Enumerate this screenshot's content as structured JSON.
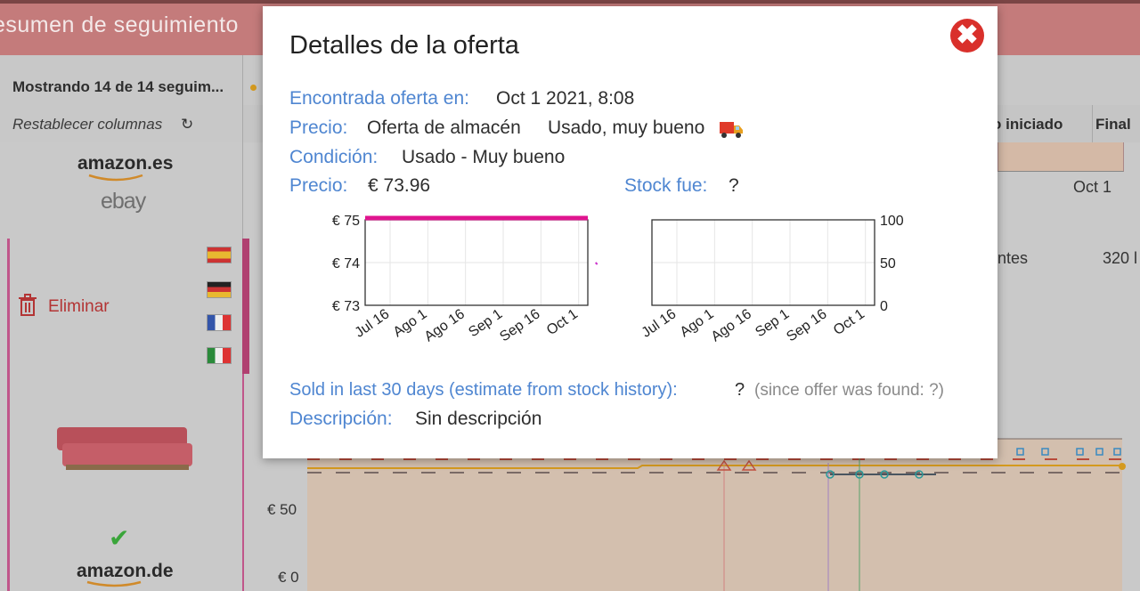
{
  "page": {
    "header_title": "esumen de seguimiento",
    "showing": "Mostrando 14 de 14 seguim...",
    "reset_columns": "Restablecer columnas",
    "col_started": "nto iniciado",
    "col_final": "Final",
    "row1": {
      "logo_1": "amazon.es",
      "logo_2": "ebay",
      "axis_label": "Oct 1"
    },
    "row2": {
      "delete_label": "Eliminar",
      "remaining": "antes",
      "remaining_value": "320 l"
    },
    "row3": {
      "logo": "amazon.de",
      "y_labels": [
        "€",
        "€ 50",
        "€ 0"
      ]
    },
    "colors": {
      "header": "#c47b7b",
      "accent_pink": "#c0568a",
      "link_blue": "#4f86d1",
      "close_red": "#d9302b"
    },
    "icons": [
      "reset-icon",
      "trash-icon",
      "flag-es-icon",
      "flag-de-icon",
      "flag-fr-icon",
      "flag-it-icon",
      "check-icon",
      "truck-icon",
      "close-icon"
    ]
  },
  "modal": {
    "title": "Detalles de la oferta",
    "found_label": "Encontrada oferta en:",
    "found_value": "Oct 1 2021, 8:08",
    "price_type_label": "Precio:",
    "price_type_value": "Oferta de almacén",
    "price_type_condition": "Usado, muy bueno",
    "condition_label": "Condición:",
    "condition_value": "Usado - Muy bueno",
    "price_label": "Precio:",
    "price_value": "€ 73.96",
    "stock_label": "Stock fue:",
    "stock_value": "?",
    "sold_label": "Sold in last 30 days (estimate from stock history):",
    "sold_value": "?",
    "sold_note": "(since offer was found: ?)",
    "desc_label": "Descripción:",
    "desc_value": "Sin descripción"
  },
  "chart_data": [
    {
      "type": "line",
      "x_tick_labels": [
        "Jul 16",
        "Ago 1",
        "Ago 16",
        "Sep 1",
        "Sep 16",
        "Oct 1"
      ],
      "y_tick_labels": [
        "€ 75",
        "€ 74",
        "€ 73"
      ],
      "ylim": [
        73,
        75
      ],
      "series": [
        {
          "color": "#e0148f",
          "values": [
            75,
            75,
            75,
            75,
            75,
            75
          ]
        },
        {
          "color": "#cc33cc",
          "points": [
            {
              "x": "Oct 1",
              "y": 74
            }
          ]
        }
      ]
    },
    {
      "type": "line",
      "x_tick_labels": [
        "Jul 16",
        "Ago 1",
        "Ago 16",
        "Sep 1",
        "Sep 16",
        "Oct 1"
      ],
      "y_tick_labels": [
        "100",
        "50",
        "0"
      ],
      "ylim": [
        0,
        100
      ],
      "series": []
    }
  ]
}
